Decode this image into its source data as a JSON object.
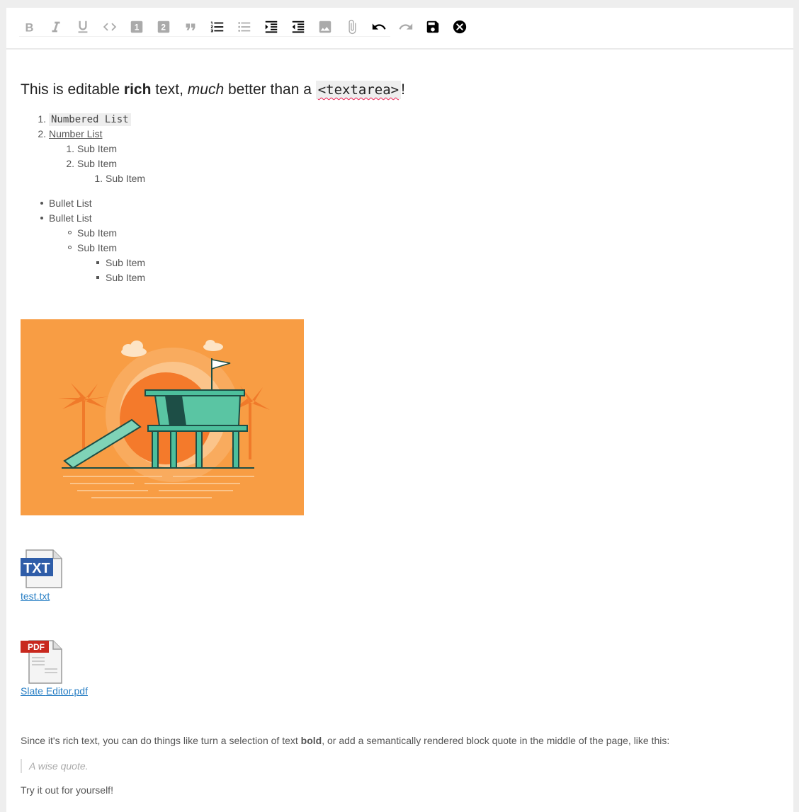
{
  "toolbar": {
    "buttons": [
      {
        "name": "bold-button",
        "icon": "bold-icon",
        "active": false
      },
      {
        "name": "italic-button",
        "icon": "italic-icon",
        "active": false
      },
      {
        "name": "underline-button",
        "icon": "underline-icon",
        "active": false
      },
      {
        "name": "code-button",
        "icon": "code-icon",
        "active": false
      },
      {
        "name": "heading-one-button",
        "icon": "heading-one-icon",
        "active": false
      },
      {
        "name": "heading-two-button",
        "icon": "heading-two-icon",
        "active": false
      },
      {
        "name": "block-quote-button",
        "icon": "quote-icon",
        "active": false
      },
      {
        "name": "numbered-list-button",
        "icon": "numbered-list-icon",
        "active": true
      },
      {
        "name": "bulleted-list-button",
        "icon": "bulleted-list-icon",
        "active": false
      },
      {
        "name": "indent-button",
        "icon": "indent-icon",
        "active": true
      },
      {
        "name": "outdent-button",
        "icon": "outdent-icon",
        "active": true
      },
      {
        "name": "insert-image-button",
        "icon": "image-icon",
        "active": false
      },
      {
        "name": "attach-file-button",
        "icon": "paperclip-icon",
        "active": false
      },
      {
        "name": "undo-button",
        "icon": "undo-icon",
        "active": true
      },
      {
        "name": "redo-button",
        "icon": "redo-icon",
        "active": false
      },
      {
        "name": "save-button",
        "icon": "save-icon",
        "active": true
      },
      {
        "name": "close-button",
        "icon": "close-circle-icon",
        "active": true
      }
    ],
    "active_color": "#000000",
    "inactive_color": "#aaaaaa"
  },
  "headline": {
    "pre": "This is editable ",
    "bold": "rich",
    "mid1": " text, ",
    "italic": "much",
    "mid2": " better than a ",
    "code": "<textarea>",
    "post": "!"
  },
  "numbered_list": {
    "item1": "Numbered List",
    "item2": "Number List",
    "sub1": "Sub Item",
    "sub2": "Sub Item",
    "subsub1": "Sub Item",
    "markers": [
      "1.",
      "2.",
      "1.",
      "2.",
      "1."
    ]
  },
  "bulleted_list": {
    "item1": "Bullet List",
    "item2": "Bullet List",
    "sub1": "Sub Item",
    "sub2": "Sub Item",
    "subsub1": "Sub Item",
    "subsub2": "Sub Item"
  },
  "image": {
    "icon": "lifeguard-tower-illustration",
    "bg_color": "#f89d44"
  },
  "attachments": [
    {
      "filename": "test.txt",
      "icon": "txt-file-icon",
      "badge": "TXT"
    },
    {
      "filename_part1": "Slate ",
      "filename_part2": "Editor.pdf",
      "icon": "pdf-file-icon",
      "badge": "PDF"
    }
  ],
  "body": {
    "para1_pre": "Since it's rich text, you can do things like turn a selection of text ",
    "para1_bold": "bold",
    "para1_post": ", or add a semantically rendered block quote in the middle of the page, like this:",
    "quote": "A wise quote.",
    "para2": "Try it out for yourself!"
  },
  "link_color": "#2b80c5"
}
